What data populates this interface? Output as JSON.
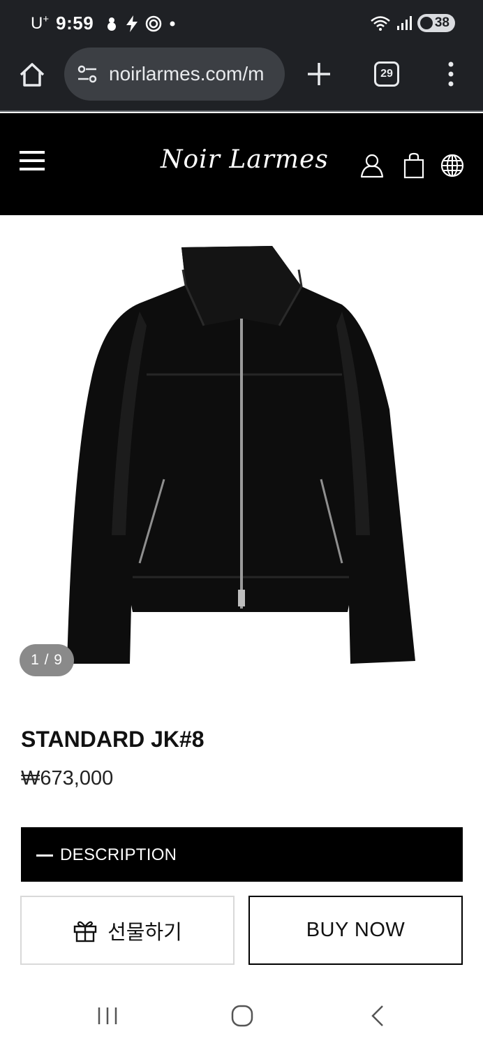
{
  "status_bar": {
    "carrier": "U",
    "carrier_sup": "+",
    "time": "9:59",
    "battery": "38",
    "icons": [
      "snowman-icon",
      "bolt-icon",
      "target-icon",
      "dot-icon",
      "wifi-icon",
      "signal-icon",
      "battery-icon"
    ]
  },
  "browser": {
    "url": "noirlarmes.com/m",
    "tab_count": "29",
    "icons": [
      "home-icon",
      "site-settings-icon",
      "plus-icon",
      "tabs-icon",
      "more-vert-icon"
    ]
  },
  "site_header": {
    "brand": "Noir Larmes",
    "icons": [
      "hamburger-icon",
      "account-icon",
      "bag-icon",
      "globe-icon"
    ]
  },
  "gallery": {
    "counter": "1 / 9"
  },
  "product": {
    "name": "STANDARD JK#8",
    "price": "₩673,000",
    "description_label": "DESCRIPTION"
  },
  "actions": {
    "gift_label": "선물하기",
    "buy_label": "BUY NOW"
  },
  "colors": {
    "chrome_bg": "#1f2125",
    "url_pill_bg": "#3c3f44",
    "site_header_bg": "#000000",
    "counter_bg": "#8a8a8a"
  }
}
